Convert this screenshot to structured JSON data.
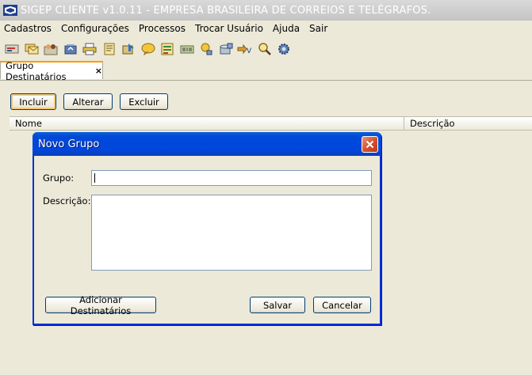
{
  "window": {
    "title": "SIGEP CLIENTE v1.0.11 - EMPRESA BRASILEIRA DE CORREIOS E TELÉGRAFOS."
  },
  "menu": [
    "Cadastros",
    "Configurações",
    "Processos",
    "Trocar Usuário",
    "Ajuda",
    "Sair"
  ],
  "toolbar": {
    "icons": [
      "card-icon",
      "envelopes-icon",
      "people-icon",
      "package-icon",
      "printer-icon",
      "document-icon",
      "box-arrow-icon",
      "chat-icon",
      "list-icon",
      "barcode-icon",
      "user-search-icon",
      "database-icon",
      "arrow-v-icon",
      "magnifier-icon",
      "gear-icon"
    ]
  },
  "tab": {
    "label": "Grupo Destinatários",
    "close": "×"
  },
  "actions": {
    "incluir": "Incluir",
    "alterar": "Alterar",
    "excluir": "Excluir"
  },
  "table": {
    "columns": [
      "Nome",
      "Descrição"
    ]
  },
  "dialog": {
    "title": "Novo Grupo",
    "grupo_label": "Grupo:",
    "grupo_value": "",
    "descricao_label": "Descrição:",
    "descricao_value": "",
    "add_button": "Adicionar Destinatários",
    "save_button": "Salvar",
    "cancel_button": "Cancelar"
  },
  "colors": {
    "title_bar": "#c4c4c4",
    "dialog_title": "#0047e0",
    "tab_accent": "#ff9900",
    "close_button": "#d34f2b"
  }
}
